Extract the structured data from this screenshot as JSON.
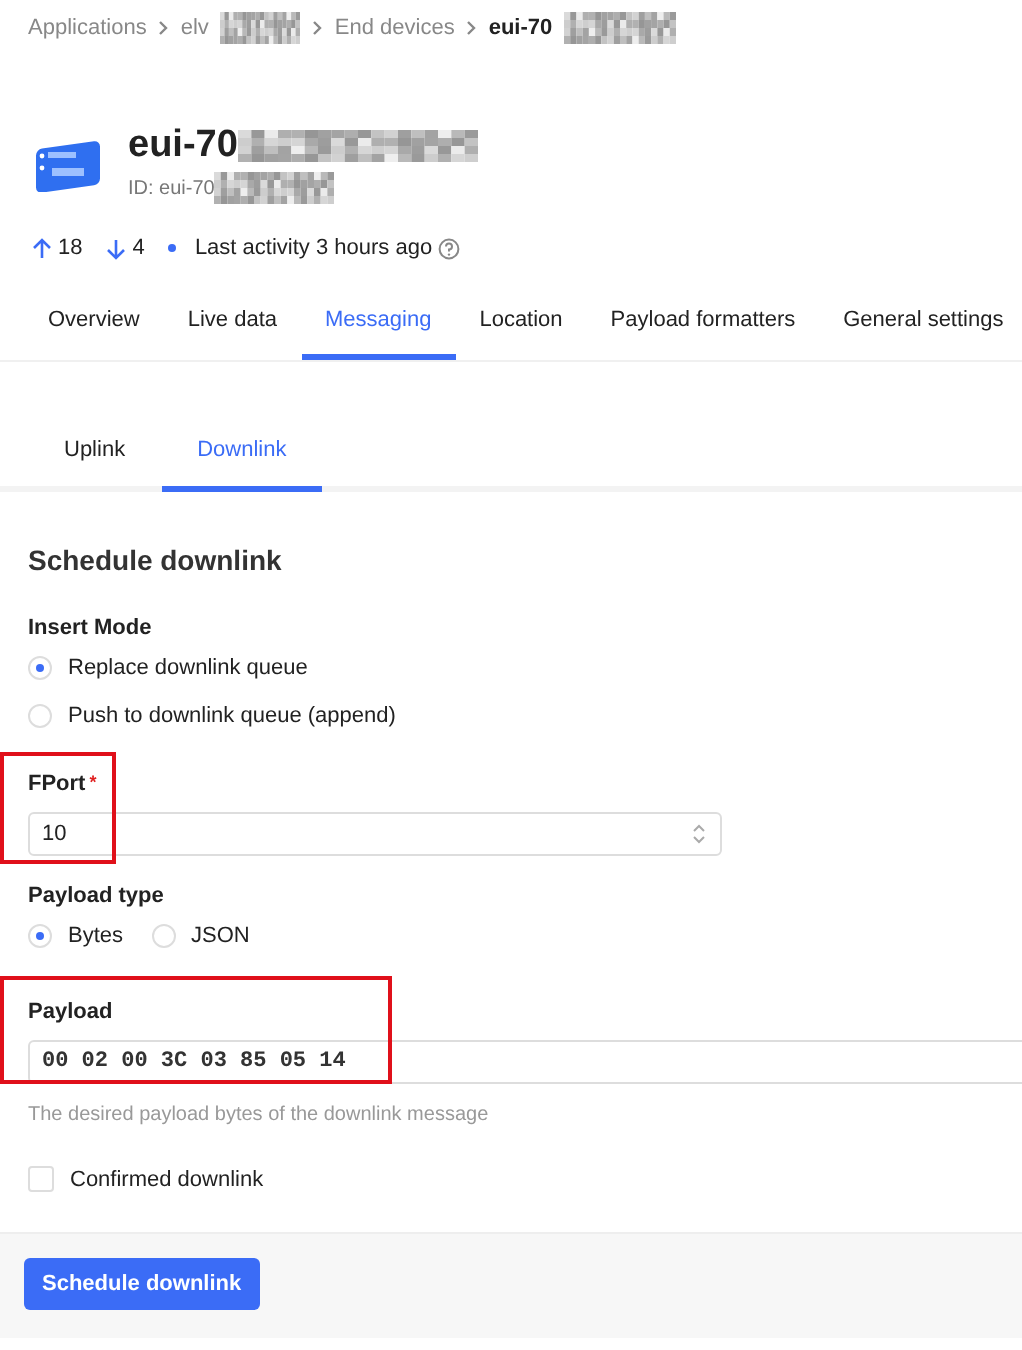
{
  "breadcrumb": [
    {
      "label": "Applications",
      "redacted": false,
      "current": false
    },
    {
      "label": "elv",
      "redacted": true,
      "current": false
    },
    {
      "label": "End devices",
      "redacted": false,
      "current": false
    },
    {
      "label": "eui-70",
      "redacted": true,
      "current": true
    }
  ],
  "device": {
    "name": "eui-70",
    "id": "ID: eui-70",
    "redacted": true
  },
  "stats": {
    "uplinks": "18",
    "downlinks": "4",
    "activity": "Last activity 3 hours ago"
  },
  "tabs": [
    {
      "label": "Overview",
      "selected": false
    },
    {
      "label": "Live data",
      "selected": false
    },
    {
      "label": "Messaging",
      "selected": true
    },
    {
      "label": "Location",
      "selected": false
    },
    {
      "label": "Payload formatters",
      "selected": false
    },
    {
      "label": "General settings",
      "selected": false
    }
  ],
  "subtabs": [
    {
      "label": "Uplink",
      "selected": false
    },
    {
      "label": "Downlink",
      "selected": true
    }
  ],
  "form": {
    "title": "Schedule downlink",
    "insert_mode": {
      "label": "Insert Mode",
      "options": [
        {
          "label": "Replace downlink queue",
          "selected": true
        },
        {
          "label": "Push to downlink queue (append)",
          "selected": false
        }
      ]
    },
    "fport": {
      "label": "FPort",
      "required_mark": "*",
      "value": "10",
      "highlighted": true
    },
    "payload_type": {
      "label": "Payload type",
      "options": [
        {
          "label": "Bytes",
          "selected": true
        },
        {
          "label": "JSON",
          "selected": false
        }
      ]
    },
    "payload": {
      "label": "Payload",
      "value": "00 02 00 3C 03 85 05 14",
      "help": "The desired payload bytes of the downlink message",
      "highlighted": true
    },
    "confirmed": {
      "label": "Confirmed downlink",
      "checked": false
    },
    "submit": "Schedule downlink"
  }
}
